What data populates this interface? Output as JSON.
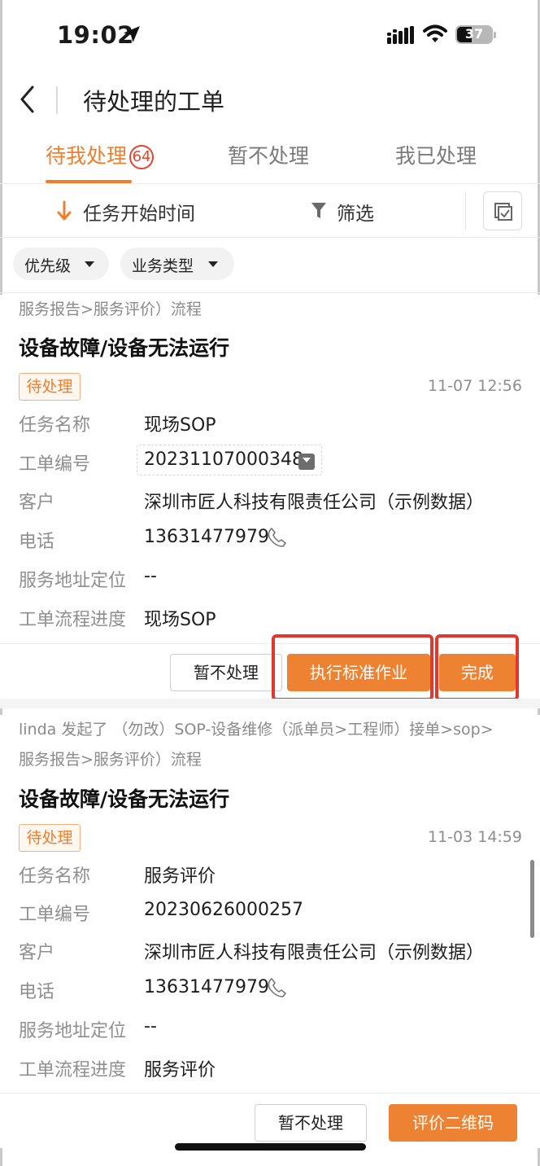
{
  "status_bar": {
    "time": "19:02",
    "battery": "37"
  },
  "nav": {
    "title": "待处理的工单"
  },
  "tabs": [
    {
      "label": "待我处理",
      "badge": "64",
      "active": true
    },
    {
      "label": "暂不处理",
      "active": false
    },
    {
      "label": "我已处理",
      "active": false
    }
  ],
  "sort": {
    "label": "任务开始时间",
    "filter_label": "筛选"
  },
  "chips": [
    {
      "label": "优先级"
    },
    {
      "label": "业务类型"
    }
  ],
  "field_labels": {
    "task_name": "任务名称",
    "order_no": "工单编号",
    "customer": "客户",
    "phone": "电话",
    "address": "服务地址定位",
    "progress": "工单流程进度"
  },
  "cards": [
    {
      "flow_text": "服务报告>服务评价）流程",
      "title": "设备故障/设备无法运行",
      "status": "待处理",
      "time": "11-07 12:56",
      "task_name": "现场SOP",
      "order_no": "20231107000348",
      "customer": "深圳市匠人科技有限责任公司（示例数据）",
      "phone": "13631477979",
      "address": "--",
      "progress": "现场SOP",
      "actions": [
        "暂不处理",
        "执行标准作业",
        "完成"
      ]
    },
    {
      "flow_line1": "linda 发起了 （勿改）SOP-设备维修（派单员>工程师）接单>sop>",
      "flow_line2": "服务报告>服务评价）流程",
      "title": "设备故障/设备无法运行",
      "status": "待处理",
      "time": "11-03 14:59",
      "task_name": "服务评价",
      "order_no": "20230626000257",
      "customer": "深圳市匠人科技有限责任公司（示例数据）",
      "phone": "13631477979",
      "address": "--",
      "progress": "服务评价",
      "actions": [
        "暂不处理",
        "评价二维码"
      ]
    }
  ],
  "colors": {
    "accent": "#ee7f2d",
    "highlight": "#e3372d",
    "badge": "#e6442c"
  },
  "icons": [
    "location-arrow-icon",
    "signal-icon",
    "wifi-icon",
    "battery-icon",
    "back-icon",
    "sort-down-icon",
    "filter-icon",
    "multi-select-icon",
    "dropdown-caret-icon",
    "copy-icon",
    "phone-icon"
  ]
}
